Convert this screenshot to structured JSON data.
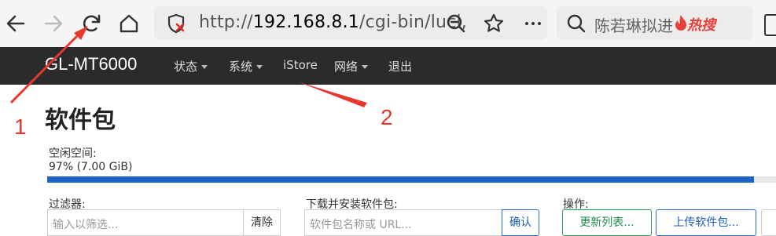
{
  "browser": {
    "url_prefix": "http://",
    "url_host": "192.168.8.1",
    "url_path": "/cgi-bin/luci,",
    "search_text": "陈若琳拟进",
    "hot_badge": "热搜",
    "icons": [
      "back-icon",
      "forward-icon",
      "reload-icon",
      "home-icon",
      "not-secure-icon",
      "zoom-icon",
      "star-icon",
      "more-icon",
      "search-icon"
    ]
  },
  "nav": {
    "brand": "GL-MT6000",
    "items": [
      {
        "label": "状态",
        "dropdown": true
      },
      {
        "label": "系统",
        "dropdown": true
      },
      {
        "label": "iStore",
        "dropdown": false
      },
      {
        "label": "网络",
        "dropdown": true
      },
      {
        "label": "退出",
        "dropdown": false
      }
    ]
  },
  "page": {
    "title": "软件包",
    "free_space_label": "空闲空间:",
    "free_space_value": "97% (7.00 GiB)",
    "free_space_percent": 97,
    "filter_label": "过滤器:",
    "filter_placeholder": "输入以筛选...",
    "clear_button": "清除",
    "download_label": "下载并安装软件包:",
    "download_placeholder": "软件包名称或 URL...",
    "confirm_button": "确认",
    "actions_label": "操作:",
    "update_button": "更新列表...",
    "upload_button": "上传软件包..."
  },
  "annotations": {
    "one": "1",
    "two": "2"
  },
  "colors": {
    "navbar": "#2b2b2b",
    "progress": "#1e63c4",
    "annotation": "#e8382d",
    "update_button": "#1d8a4c",
    "upload_button": "#1e5fb8"
  }
}
